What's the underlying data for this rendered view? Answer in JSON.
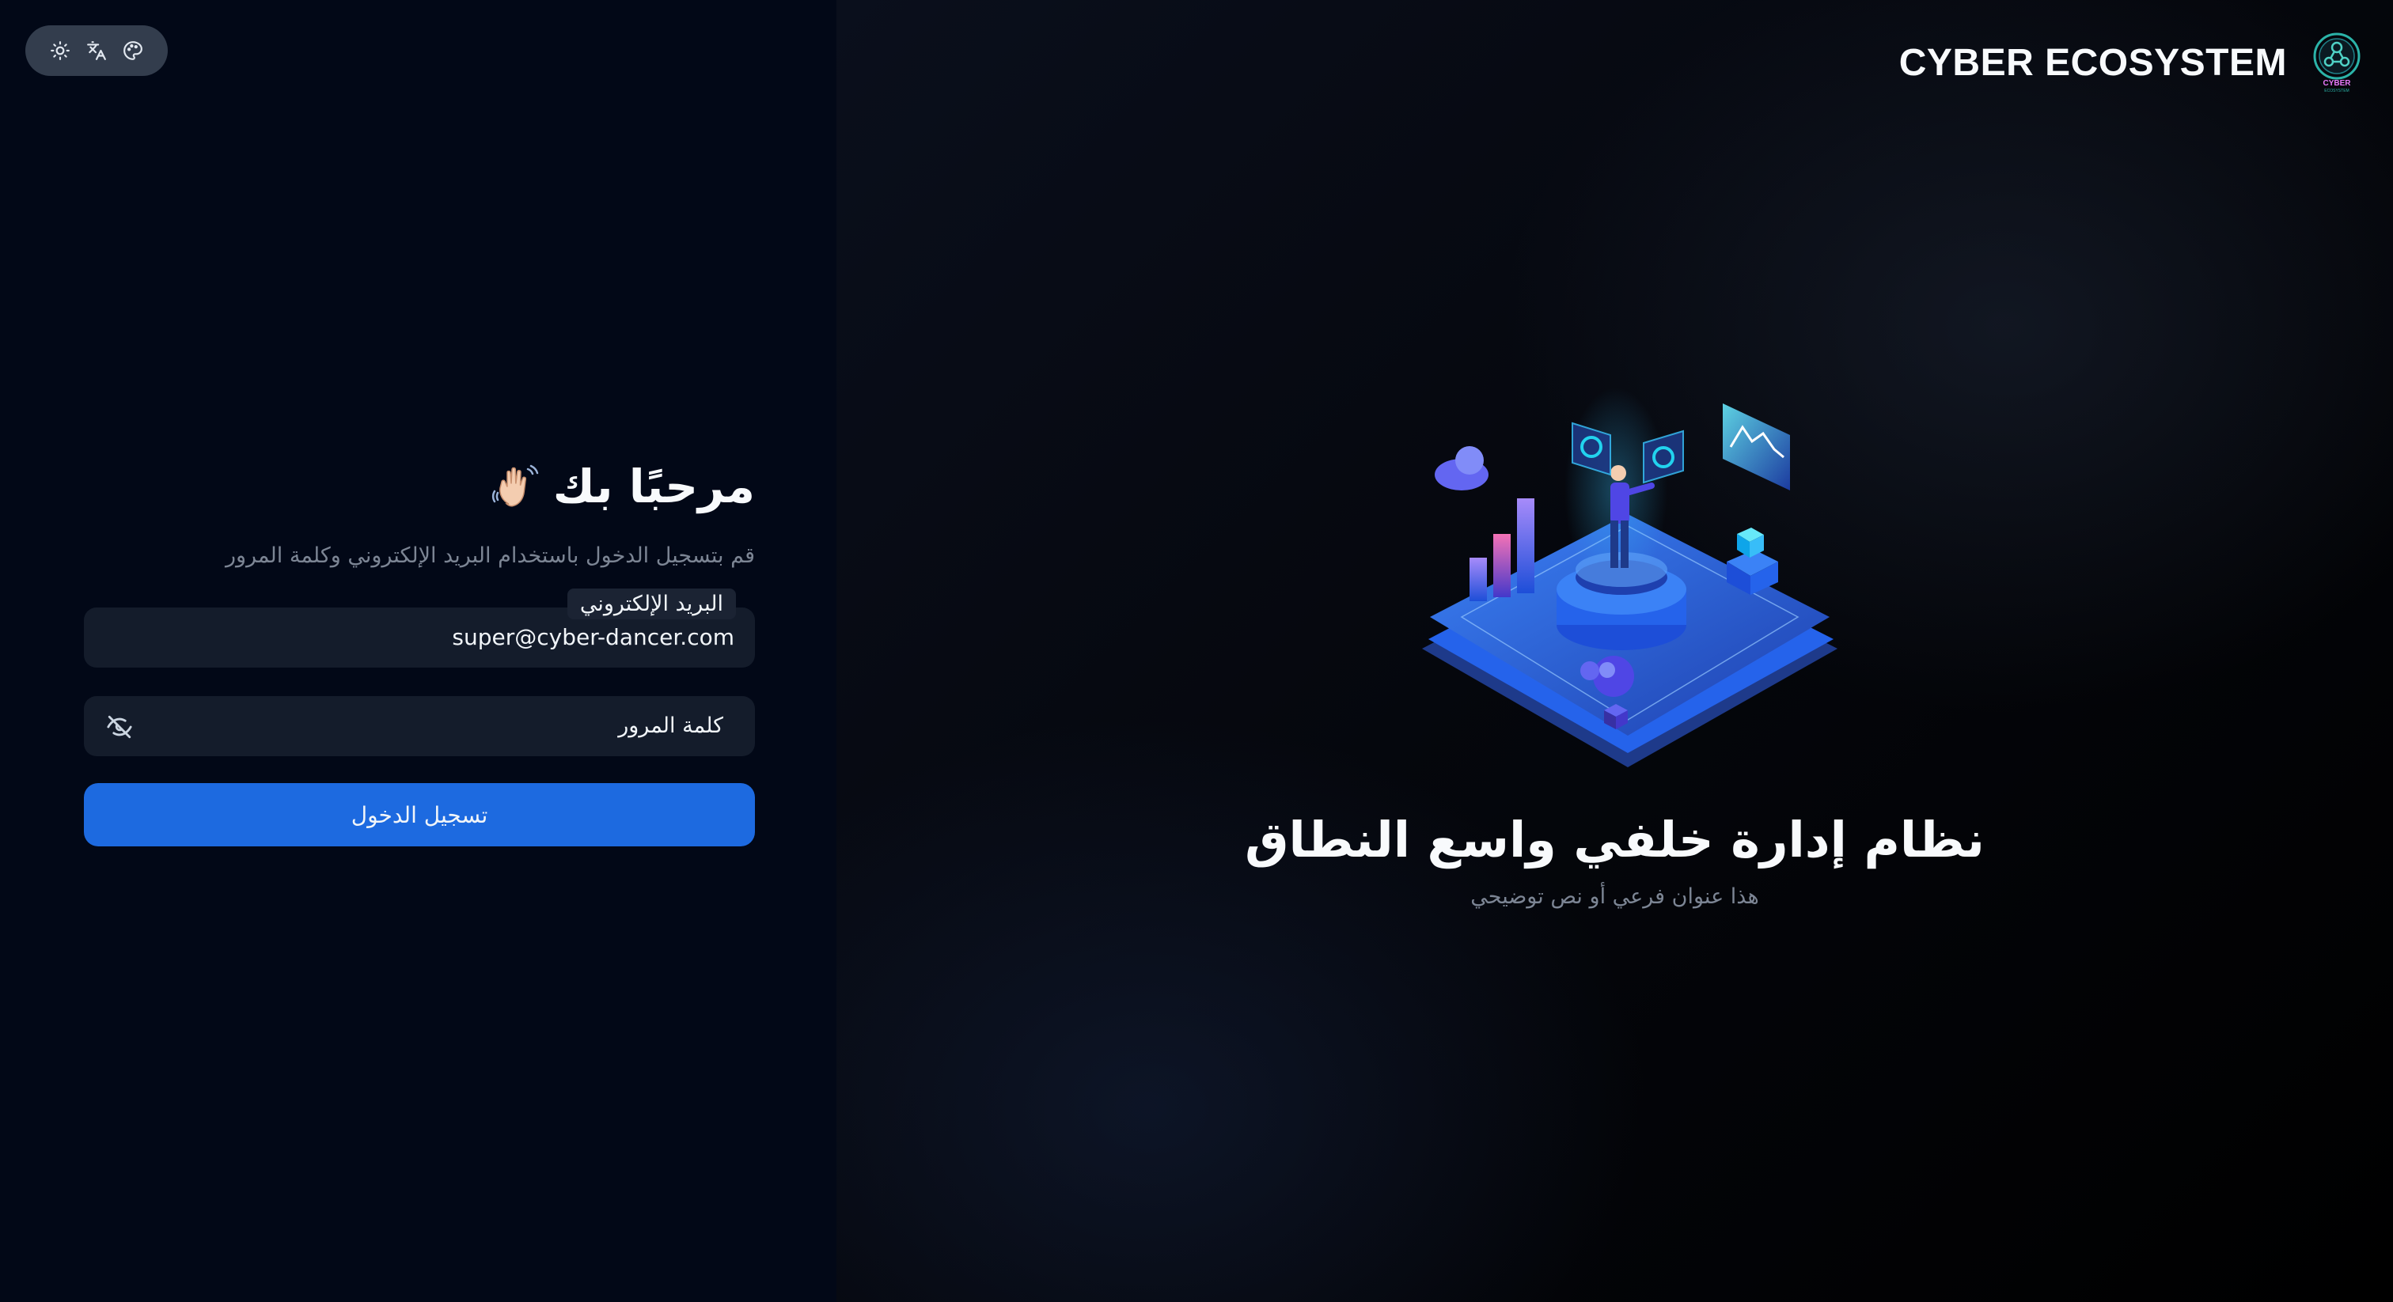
{
  "toolbar": {
    "icons": [
      "sun-icon",
      "translate-icon",
      "palette-icon"
    ]
  },
  "login": {
    "title": "مرحبًا بك",
    "subtitle": "قم بتسجيل الدخول باستخدام البريد الإلكتروني وكلمة المرور",
    "email_label": "البريد الإلكتروني",
    "email_value": "super@cyber-dancer.com",
    "password_placeholder": "كلمة المرور",
    "submit_label": "تسجيل الدخول"
  },
  "brand": {
    "name": "CYBER ECOSYSTEM",
    "logo_text": "CYBER",
    "logo_subtext": "ECOSYSTEM"
  },
  "hero": {
    "title": "نظام إدارة خلفي واسع النطاق",
    "subtitle": "هذا عنوان فرعي أو نص توضيحي"
  },
  "colors": {
    "accent": "#1d6ae0",
    "left_bg": "#020817",
    "input_bg": "#141c2b",
    "muted_text": "#7c8594"
  }
}
